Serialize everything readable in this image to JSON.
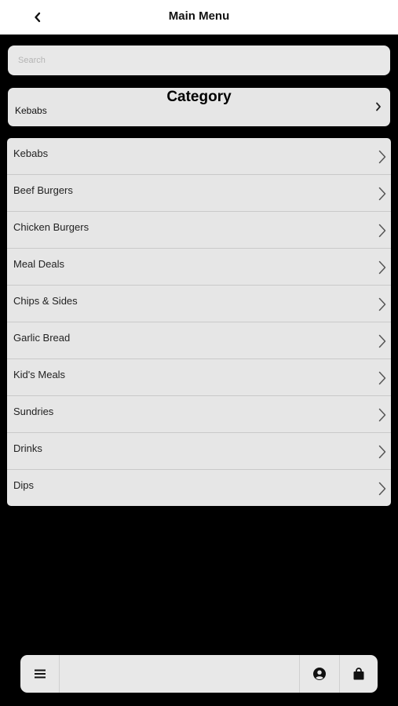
{
  "header": {
    "title": "Main Menu",
    "back_icon": "chevron-left-icon"
  },
  "search": {
    "placeholder": "Search",
    "value": ""
  },
  "category": {
    "title": "Category",
    "selected": "Kebabs",
    "icon": "chevron-right-icon"
  },
  "menu_items": [
    {
      "label": "Kebabs"
    },
    {
      "label": "Beef Burgers"
    },
    {
      "label": "Chicken Burgers"
    },
    {
      "label": "Meal Deals"
    },
    {
      "label": "Chips & Sides"
    },
    {
      "label": "Garlic Bread"
    },
    {
      "label": "Kid's Meals"
    },
    {
      "label": "Sundries"
    },
    {
      "label": "Drinks"
    },
    {
      "label": "Dips"
    }
  ],
  "bottom_bar": {
    "icons": [
      "hamburger-menu-icon",
      "user-circle-icon",
      "shopping-bag-icon"
    ]
  },
  "colors": {
    "background": "#000000",
    "header": "#ffffff",
    "panel": "#e6e6e6",
    "divider": "#c9c9c9"
  }
}
